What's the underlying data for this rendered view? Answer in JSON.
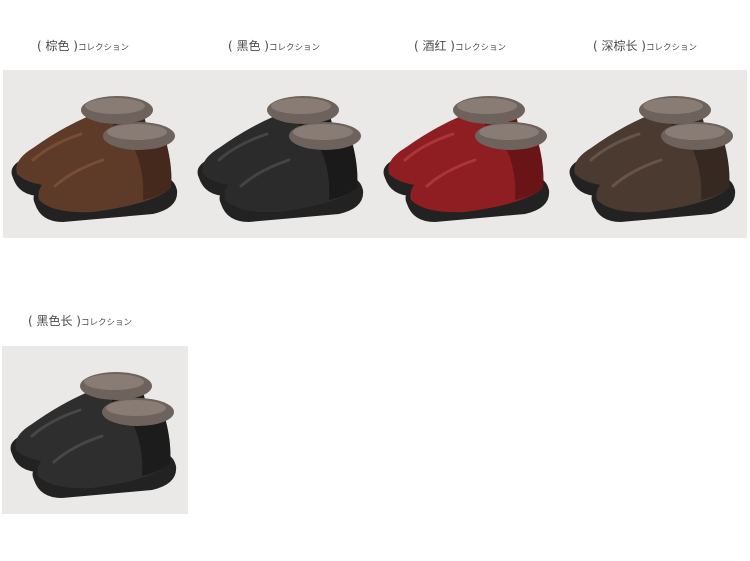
{
  "products": [
    {
      "label_main": "( 棕色 )",
      "label_sub": "コレクション",
      "shoe_color": "#5e3a28",
      "shoe_color_dark": "#3a2218",
      "shoe_highlight": "#8a5a40"
    },
    {
      "label_main": "( 黑色 )",
      "label_sub": "コレクション",
      "shoe_color": "#2b2b2b",
      "shoe_color_dark": "#141414",
      "shoe_highlight": "#555555"
    },
    {
      "label_main": "( 酒红 )",
      "label_sub": "コレクション",
      "shoe_color": "#8e1e22",
      "shoe_color_dark": "#5a1013",
      "shoe_highlight": "#c04448"
    },
    {
      "label_main": "( 深棕长 )",
      "label_sub": "コレクション",
      "shoe_color": "#4a3a30",
      "shoe_color_dark": "#2c221c",
      "shoe_highlight": "#7a6658"
    },
    {
      "label_main": "( 黑色长 )",
      "label_sub": "コレクション",
      "shoe_color": "#2e2e2e",
      "shoe_color_dark": "#161616",
      "shoe_highlight": "#585858"
    }
  ],
  "colors": {
    "fur": "#6e625c",
    "fur_light": "#9a8e86",
    "sole": "#222222",
    "backdrop": "#ebe9e8"
  }
}
